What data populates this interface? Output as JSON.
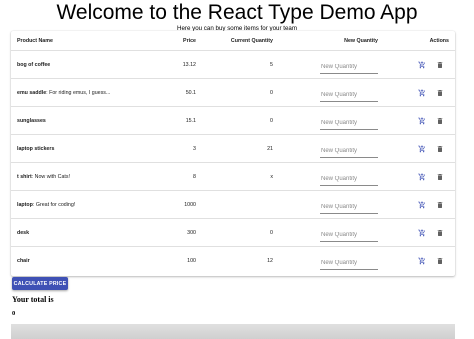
{
  "header": {
    "title": "Welcome to the React Type Demo App",
    "subtitle": "Here you can buy some items for your team"
  },
  "table": {
    "columns": {
      "name": "Product Name",
      "price": "Price",
      "quantity": "Current Quantity",
      "new_quantity": "New Quantity",
      "actions": "Actions"
    },
    "input_placeholder": "New Quantity",
    "rows": [
      {
        "name": "bog of coffee",
        "description": "",
        "price": "13.12",
        "quantity": "5"
      },
      {
        "name": "emu saddle",
        "description": ": For riding emus, I guess...",
        "price": "50.1",
        "quantity": "0"
      },
      {
        "name": "sunglasses",
        "description": "",
        "price": "15.1",
        "quantity": "0"
      },
      {
        "name": "laptop stickers",
        "description": "",
        "price": "3",
        "quantity": "21"
      },
      {
        "name": "t shirt",
        "description": ": Now with Cats!",
        "price": "8",
        "quantity": "x"
      },
      {
        "name": "laptop",
        "description": ": Great for coding!",
        "price": "1000",
        "quantity": ""
      },
      {
        "name": "desk",
        "description": "",
        "price": "300",
        "quantity": "0"
      },
      {
        "name": "chair",
        "description": "",
        "price": "100",
        "quantity": "12"
      }
    ]
  },
  "actions": {
    "calculate_label": "CALCULATE PRICE",
    "add_icon": "add-shopping-cart-icon",
    "delete_icon": "trash-icon"
  },
  "total": {
    "label": "Your total is",
    "value": "0"
  },
  "colors": {
    "primary": "#3f51b5",
    "icon_gray": "#616161"
  }
}
